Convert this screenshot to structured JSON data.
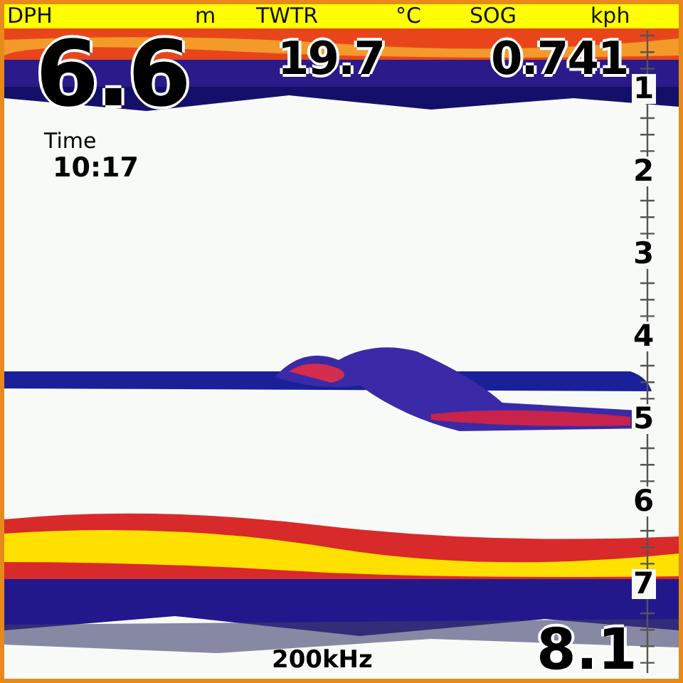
{
  "readouts": [
    {
      "label": "DPH",
      "unit": "m",
      "value": "6.6"
    },
    {
      "label": "TWTR",
      "unit": "°C",
      "value": "19.7"
    },
    {
      "label": "SOG",
      "unit": "kph",
      "value": "0.741"
    }
  ],
  "time": {
    "label": "Time",
    "value": "10:17"
  },
  "depth_scale": {
    "labels": [
      "1",
      "2",
      "3",
      "4",
      "5",
      "6",
      "7"
    ]
  },
  "frequency": "200kHz",
  "bottom_depth": "8.1"
}
